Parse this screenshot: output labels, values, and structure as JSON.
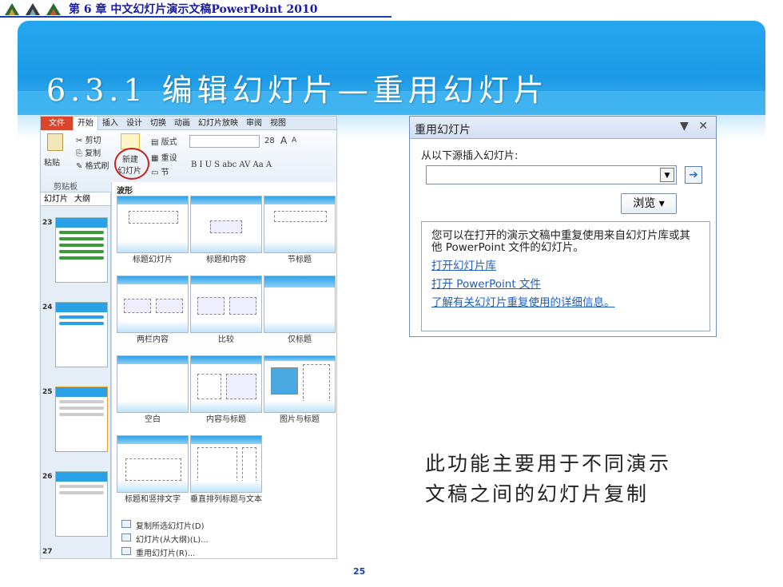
{
  "header": {
    "chapter_title": "第 6 章   中文幻灯片演示文稿PowerPoint 2010"
  },
  "slide": {
    "title": "6.3.1 编辑幻灯片—重用幻灯片",
    "caption_line1": "此功能主要用于不同演示",
    "caption_line2": "文稿之间的幻灯片复制",
    "page_number": "25"
  },
  "ppt": {
    "tabs": [
      "文件",
      "开始",
      "插入",
      "设计",
      "切换",
      "动画",
      "幻灯片放映",
      "审阅",
      "视图"
    ],
    "ribbon": {
      "paste": "粘贴",
      "cut": "剪切",
      "copy": "复制",
      "format_painter": "格式刷",
      "clipboard_group": "剪贴板",
      "new_slide_top": "新建",
      "new_slide_bottom": "幻灯片",
      "layout": "版式",
      "reset": "重设",
      "section": "节",
      "font_size": "28",
      "font_a": "A",
      "font_a_small": "A",
      "font_style": "B  I  U  S  abc  AV  Aa  A"
    },
    "left_tabs": [
      "幻灯片",
      "大纲"
    ],
    "slide_numbers": [
      "23",
      "24",
      "25",
      "26",
      "27"
    ],
    "gallery_title": "波形",
    "layouts": [
      "标题幻灯片",
      "标题和内容",
      "节标题",
      "两栏内容",
      "比较",
      "仅标题",
      "空白",
      "内容与标题",
      "图片与标题",
      "标题和竖排文字",
      "垂直排列标题与文本"
    ],
    "commands": [
      "复制所选幻灯片(D)",
      "幻灯片(从大纲)(L)...",
      "重用幻灯片(R)..."
    ]
  },
  "reuse_panel": {
    "title": "重用幻灯片",
    "source_label": "从以下源插入幻灯片:",
    "source_value": "",
    "browse_label": "浏览 ▾",
    "description": "您可以在打开的演示文稿中重复使用来自幻灯片库或其他 PowerPoint 文件的幻灯片。",
    "links": [
      "打开幻灯片库",
      "打开 PowerPoint 文件",
      "了解有关幻灯片重复使用的详细信息。"
    ]
  }
}
